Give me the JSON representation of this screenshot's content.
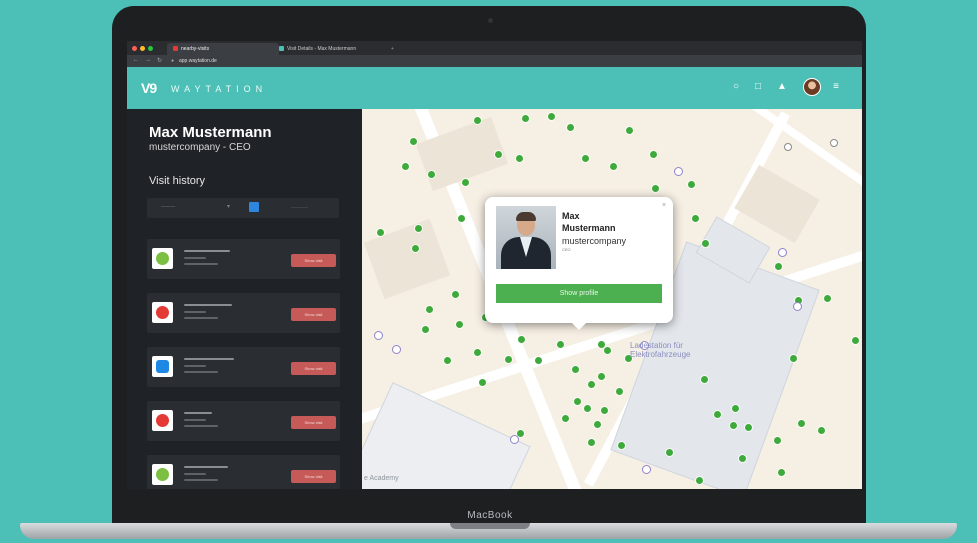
{
  "browser": {
    "tabs": [
      "nearby-visits",
      "Visit Details - Max Mustermann"
    ],
    "url": "app.waytation.de"
  },
  "header": {
    "logo_mark": "V9",
    "logo_text": "WAYTATION"
  },
  "sidebar": {
    "user_name": "Max Mustermann",
    "user_subtitle": "mustercompany - CEO",
    "history_title": "Visit history",
    "visits": [
      {
        "logo_color": "#7bc043",
        "action": "Show visit"
      },
      {
        "logo_color": "#e53935",
        "action": "Show visit"
      },
      {
        "logo_color": "#1e88e5",
        "action": "Show visit"
      },
      {
        "logo_color": "#e53935",
        "action": "Show visit"
      },
      {
        "logo_color": "#7bc043",
        "action": "Show visit"
      }
    ]
  },
  "map": {
    "poi_label": "Ladestation für Elektrofahrzeuge",
    "bottom_label": "e Academy"
  },
  "popup": {
    "name": "Max Mustermann",
    "company": "mustercompany",
    "role": "CEO",
    "button": "Show profile"
  },
  "device": {
    "label": "MacBook"
  },
  "colors": {
    "accent": "#4cc0b6",
    "pin_green": "#3faa3c",
    "button_green": "#4caf50",
    "visit_button": "#c55a58",
    "sidebar_bg": "#1f2226"
  }
}
